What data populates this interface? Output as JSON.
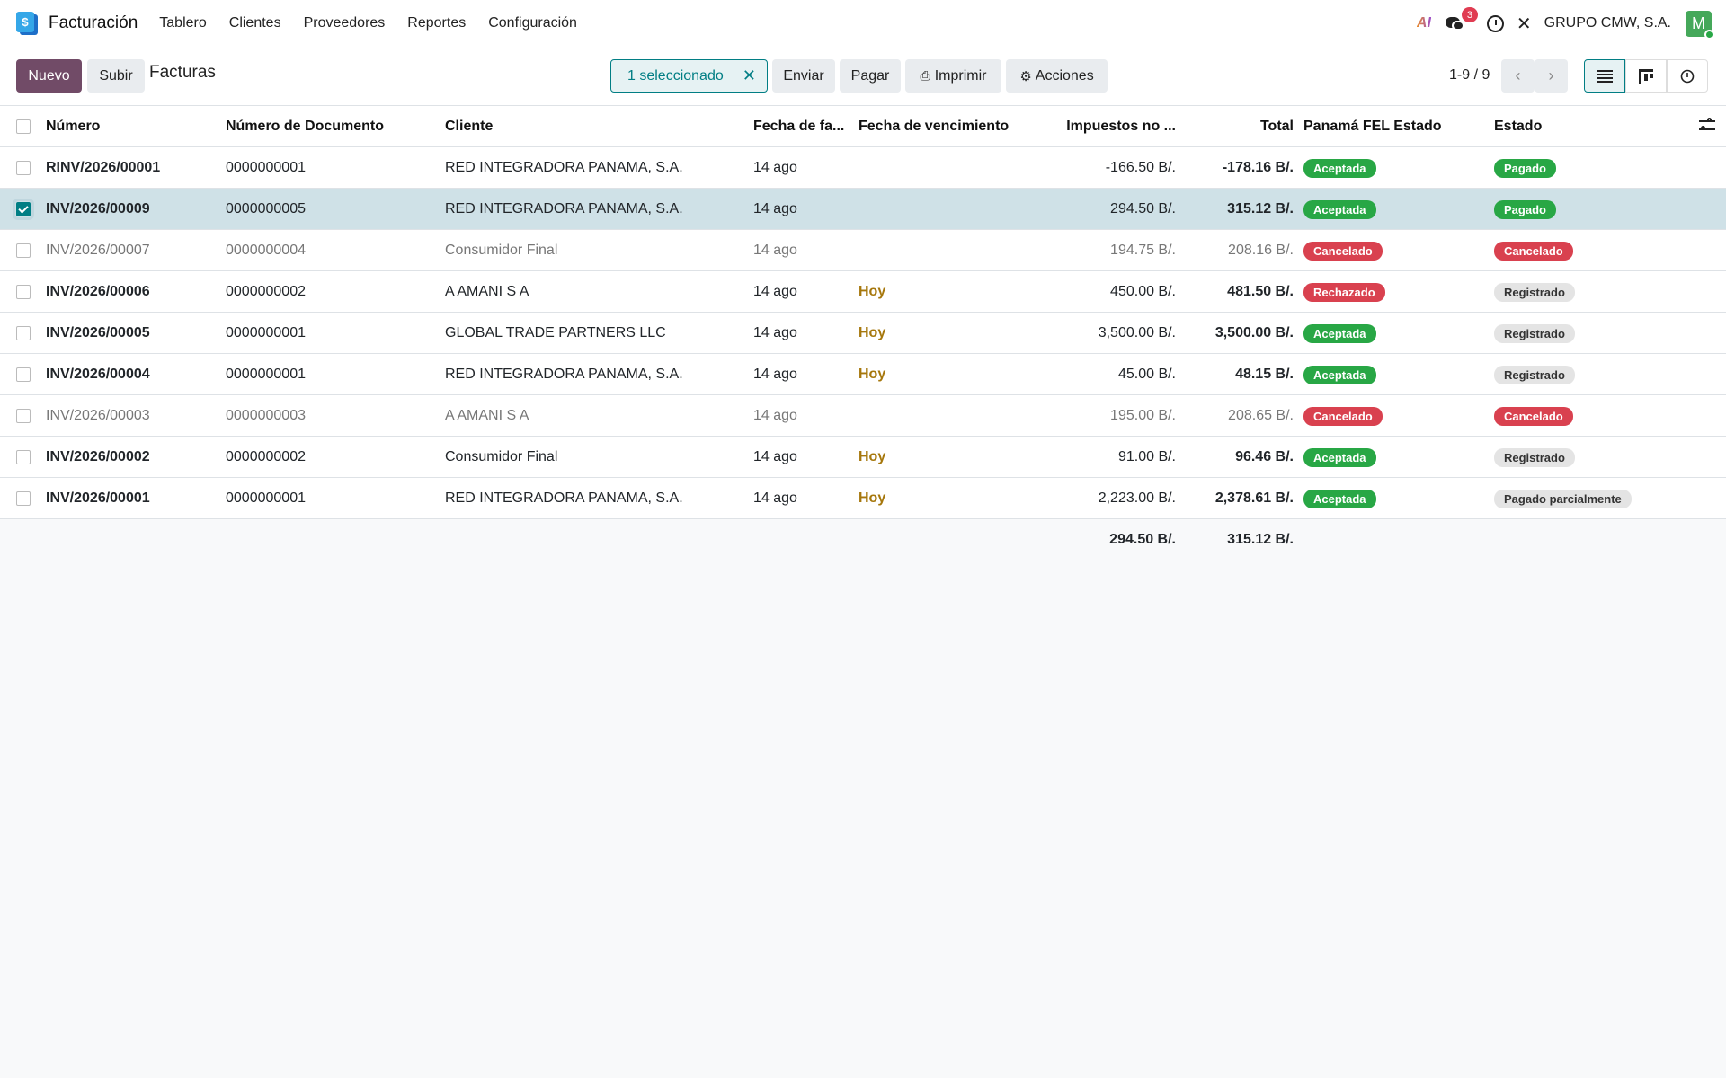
{
  "nav": {
    "app_title": "Facturación",
    "app_icon_glyph": "$",
    "menu": [
      "Tablero",
      "Clientes",
      "Proveedores",
      "Reportes",
      "Configuración"
    ],
    "ai_label": "AI",
    "messages_count": "3",
    "company": "GRUPO CMW, S.A.",
    "avatar_letter": "M"
  },
  "toolbar": {
    "new_label": "Nuevo",
    "upload_label": "Subir",
    "breadcrumb": "Facturas",
    "selection_label": "1 seleccionado",
    "selection_clear": "✕",
    "send_label": "Enviar",
    "pay_label": "Pagar",
    "print_label": "Imprimir",
    "actions_label": "Acciones",
    "pager": "1-9 / 9"
  },
  "columns": {
    "number": "Número",
    "doc_number": "Número de Documento",
    "customer": "Cliente",
    "invoice_date": "Fecha de fa...",
    "due_date": "Fecha de vencimiento",
    "tax_excluded": "Impuestos no ...",
    "total": "Total",
    "fel_state": "Panamá FEL Estado",
    "state": "Estado"
  },
  "rows": [
    {
      "number": "RINV/2026/00001",
      "doc": "0000000001",
      "customer": "RED INTEGRADORA PANAMA, S.A.",
      "date": "14 ago",
      "due": "",
      "tax": "-166.50 B/.",
      "total": "-178.16 B/.",
      "fel": "Aceptada",
      "fel_color": "green",
      "state": "Pagado",
      "state_color": "green",
      "selected": false,
      "muted": false
    },
    {
      "number": "INV/2026/00009",
      "doc": "0000000005",
      "customer": "RED INTEGRADORA PANAMA, S.A.",
      "date": "14 ago",
      "due": "",
      "tax": "294.50 B/.",
      "total": "315.12 B/.",
      "fel": "Aceptada",
      "fel_color": "green",
      "state": "Pagado",
      "state_color": "green",
      "selected": true,
      "muted": false
    },
    {
      "number": "INV/2026/00007",
      "doc": "0000000004",
      "customer": "Consumidor Final",
      "date": "14 ago",
      "due": "",
      "tax": "194.75 B/.",
      "total": "208.16 B/.",
      "fel": "Cancelado",
      "fel_color": "red",
      "state": "Cancelado",
      "state_color": "red",
      "selected": false,
      "muted": true
    },
    {
      "number": "INV/2026/00006",
      "doc": "0000000002",
      "customer": "A AMANI S A",
      "date": "14 ago",
      "due": "Hoy",
      "tax": "450.00 B/.",
      "total": "481.50 B/.",
      "fel": "Rechazado",
      "fel_color": "red",
      "state": "Registrado",
      "state_color": "grey",
      "selected": false,
      "muted": false
    },
    {
      "number": "INV/2026/00005",
      "doc": "0000000001",
      "customer": "GLOBAL TRADE PARTNERS LLC",
      "date": "14 ago",
      "due": "Hoy",
      "tax": "3,500.00 B/.",
      "total": "3,500.00 B/.",
      "fel": "Aceptada",
      "fel_color": "green",
      "state": "Registrado",
      "state_color": "grey",
      "selected": false,
      "muted": false
    },
    {
      "number": "INV/2026/00004",
      "doc": "0000000001",
      "customer": "RED INTEGRADORA PANAMA, S.A.",
      "date": "14 ago",
      "due": "Hoy",
      "tax": "45.00 B/.",
      "total": "48.15 B/.",
      "fel": "Aceptada",
      "fel_color": "green",
      "state": "Registrado",
      "state_color": "grey",
      "selected": false,
      "muted": false
    },
    {
      "number": "INV/2026/00003",
      "doc": "0000000003",
      "customer": "A AMANI S A",
      "date": "14 ago",
      "due": "",
      "tax": "195.00 B/.",
      "total": "208.65 B/.",
      "fel": "Cancelado",
      "fel_color": "red",
      "state": "Cancelado",
      "state_color": "red",
      "selected": false,
      "muted": true
    },
    {
      "number": "INV/2026/00002",
      "doc": "0000000002",
      "customer": "Consumidor Final",
      "date": "14 ago",
      "due": "Hoy",
      "tax": "91.00 B/.",
      "total": "96.46 B/.",
      "fel": "Aceptada",
      "fel_color": "green",
      "state": "Registrado",
      "state_color": "grey",
      "selected": false,
      "muted": false
    },
    {
      "number": "INV/2026/00001",
      "doc": "0000000001",
      "customer": "RED INTEGRADORA PANAMA, S.A.",
      "date": "14 ago",
      "due": "Hoy",
      "tax": "2,223.00 B/.",
      "total": "2,378.61 B/.",
      "fel": "Aceptada",
      "fel_color": "green",
      "state": "Pagado parcialmente",
      "state_color": "grey",
      "selected": false,
      "muted": false
    }
  ],
  "totals": {
    "tax": "294.50 B/.",
    "total": "315.12 B/."
  }
}
